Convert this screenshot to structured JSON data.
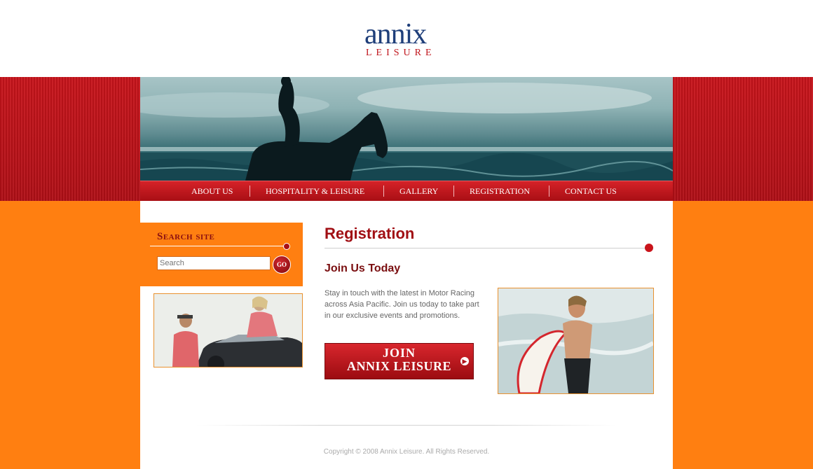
{
  "brand": {
    "logo_word": "annix",
    "logo_sub": "LEISURE"
  },
  "nav": {
    "items": [
      {
        "label": "ABOUT US"
      },
      {
        "label": "HOSPITALITY & LEISURE"
      },
      {
        "label": "GALLERY"
      },
      {
        "label": "REGISTRATION"
      },
      {
        "label": "CONTACT US"
      }
    ]
  },
  "search": {
    "title": "Search site",
    "placeholder": "Search",
    "go_label": "GO"
  },
  "main": {
    "title": "Registration",
    "subtitle": "Join Us Today",
    "body": "Stay in touch with the latest in Motor Racing across Asia Pacific. Join us today to take part in our exclusive events and promotions.",
    "join_line1": "JOIN",
    "join_line2": "ANNIX LEISURE"
  },
  "footer": {
    "copyright": "Copyright © 2008 Annix Leisure. All Rights Reserved."
  },
  "colors": {
    "brand_blue": "#1f3f7a",
    "brand_red": "#c0141b",
    "accent_orange": "#ff7f11",
    "title_red": "#a10f14"
  }
}
